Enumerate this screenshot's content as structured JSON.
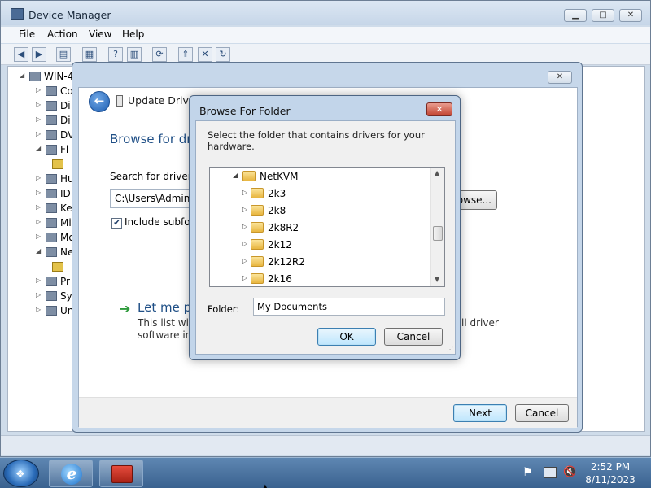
{
  "device_manager": {
    "title": "Device Manager",
    "menu": [
      "File",
      "Action",
      "View",
      "Help"
    ],
    "tree_root": "WIN-4",
    "tree_items": [
      "Co",
      "Di",
      "Di",
      "DV",
      "Fl",
      "Hu",
      "ID",
      "Ke",
      "Mi",
      "Mo",
      "Ne",
      "Pr",
      "Sy",
      "Un"
    ]
  },
  "update_driver": {
    "title": "Update Driver Software - ... ",
    "heading": "Browse for dri",
    "search_label": "Search for driver so",
    "path_value": "C:\\Users\\Adminis",
    "browse_label": "rowse...",
    "include_subfolders_label": "Include subfold",
    "include_subfolders_checked": true,
    "let_me_label": "Let me pi",
    "desc_line1": "This list will s",
    "desc_line2": "software in t",
    "desc_tail": "ll driver",
    "next_label": "Next",
    "cancel_label": "Cancel"
  },
  "browse_folder": {
    "title": "Browse For Folder",
    "prompt": "Select the folder that contains drivers for your hardware.",
    "tree": [
      {
        "label": "NetKVM",
        "expanded": true,
        "level": 0
      },
      {
        "label": "2k3",
        "expanded": false,
        "level": 1
      },
      {
        "label": "2k8",
        "expanded": false,
        "level": 1
      },
      {
        "label": "2k8R2",
        "expanded": false,
        "level": 1
      },
      {
        "label": "2k12",
        "expanded": false,
        "level": 1
      },
      {
        "label": "2k12R2",
        "expanded": false,
        "level": 1
      },
      {
        "label": "2k16",
        "expanded": false,
        "level": 1
      }
    ],
    "folder_label": "Folder:",
    "folder_value": "My Documents",
    "ok_label": "OK",
    "cancel_label": "Cancel"
  },
  "taskbar": {
    "time": "2:52 PM",
    "date": "8/11/2023"
  }
}
